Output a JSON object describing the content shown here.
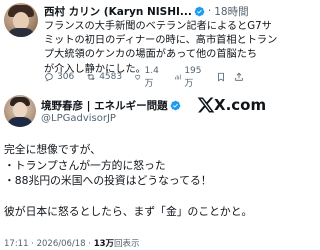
{
  "post1": {
    "author_name": "西村 カリン (Karyn NISHI...",
    "time": "18時間",
    "text_lines": [
      "フランスの大手新聞のベテラン記者によるとG7サ",
      "ミットの初日のディナーの時に、高市首相とトラン",
      "プ大統領のケンカの場面があって他の首脳たち",
      "が介入し静かにした。"
    ],
    "replies": "306",
    "reposts": "4583",
    "likes": "1.4万",
    "views": "195万"
  },
  "post2": {
    "author_name": "境野春彦 | エネルギー問題",
    "handle": "@LPGadvisorJP",
    "brand_word": "X.com",
    "text_lines": [
      "完全に想像ですが、",
      "・トランプさんが一方的に怒った",
      "・88兆円の米国への投資はどうなってる！",
      "",
      "彼が日本に怒るとしたら、まず「金」のことかと。"
    ],
    "timestamp": "17:11 · 2026/06/18 · ",
    "views_bold": "13万",
    "views_suffix": "回表示"
  }
}
